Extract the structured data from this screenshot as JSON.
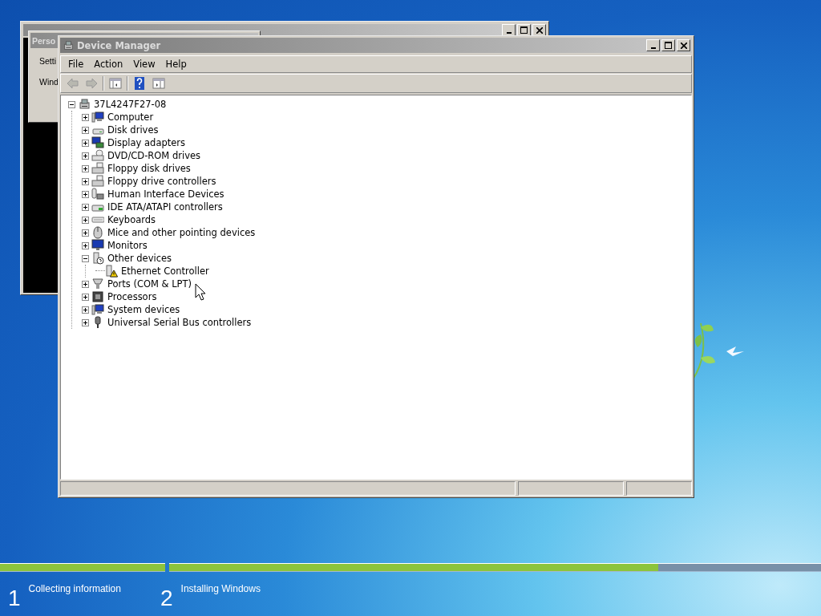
{
  "console_window": {
    "kind": "console"
  },
  "personalize_window": {
    "title": "Perso",
    "lines": [
      "Setti",
      "Wind"
    ]
  },
  "device_manager": {
    "title": "Device Manager",
    "menu": [
      "File",
      "Action",
      "View",
      "Help"
    ],
    "toolbar": [
      {
        "kind": "back",
        "disabled": true
      },
      {
        "kind": "forward",
        "disabled": true
      },
      {
        "kind": "separator"
      },
      {
        "kind": "console-tree",
        "disabled": false
      },
      {
        "kind": "separator"
      },
      {
        "kind": "help",
        "disabled": false
      },
      {
        "kind": "properties",
        "disabled": false
      }
    ],
    "tree": {
      "label": "37L4247F27-08",
      "kind": "computer-root",
      "expanded": true,
      "children": [
        {
          "label": "Computer",
          "kind": "computer",
          "expanded": false
        },
        {
          "label": "Disk drives",
          "kind": "disk",
          "expanded": false
        },
        {
          "label": "Display adapters",
          "kind": "display",
          "expanded": false
        },
        {
          "label": "DVD/CD-ROM drives",
          "kind": "dvd",
          "expanded": false
        },
        {
          "label": "Floppy disk drives",
          "kind": "floppy",
          "expanded": false
        },
        {
          "label": "Floppy drive controllers",
          "kind": "floppy",
          "expanded": false
        },
        {
          "label": "Human Interface Devices",
          "kind": "hid",
          "expanded": false
        },
        {
          "label": "IDE ATA/ATAPI controllers",
          "kind": "ide",
          "expanded": false
        },
        {
          "label": "Keyboards",
          "kind": "keyboard",
          "expanded": false
        },
        {
          "label": "Mice and other pointing devices",
          "kind": "mouse",
          "expanded": false
        },
        {
          "label": "Monitors",
          "kind": "monitor",
          "expanded": false
        },
        {
          "label": "Other devices",
          "kind": "other",
          "expanded": true,
          "children": [
            {
              "label": "Ethernet Controller",
              "kind": "unknown-device",
              "warning": true
            }
          ]
        },
        {
          "label": "Ports (COM & LPT)",
          "kind": "ports",
          "expanded": false
        },
        {
          "label": "Processors",
          "kind": "processor",
          "expanded": false
        },
        {
          "label": "System devices",
          "kind": "computer",
          "expanded": false
        },
        {
          "label": "Universal Serial Bus controllers",
          "kind": "usb",
          "expanded": false
        }
      ]
    },
    "status_bar": {
      "kind": "three-panels"
    }
  },
  "setup_steps": [
    {
      "number": "1",
      "label": "Collecting information",
      "level": 1
    },
    {
      "number": "2",
      "label": "Installing Windows",
      "level": 0.75
    }
  ]
}
